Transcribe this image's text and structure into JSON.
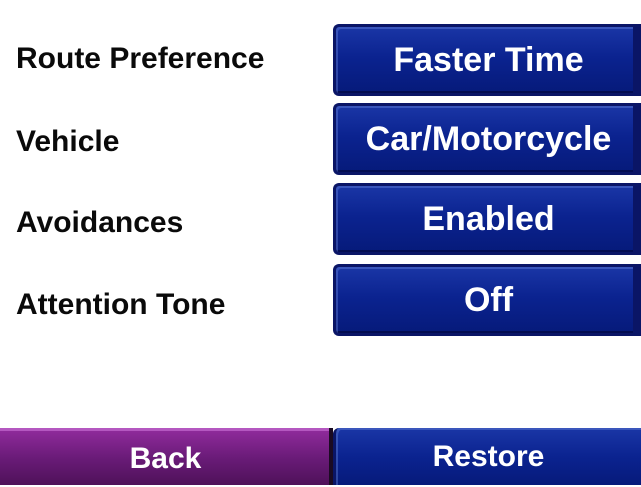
{
  "settings": [
    {
      "label": "Route Preference",
      "value": "Faster Time"
    },
    {
      "label": "Vehicle",
      "value": "Car/Motorcycle"
    },
    {
      "label": "Avoidances",
      "value": "Enabled"
    },
    {
      "label": "Attention Tone",
      "value": "Off"
    }
  ],
  "bottom_bar": {
    "back_label": "Back",
    "restore_label": "Restore"
  },
  "colors": {
    "value_button_blue": "#0b2390",
    "back_button_purple": "#6a1b78",
    "background": "#ffffff"
  }
}
